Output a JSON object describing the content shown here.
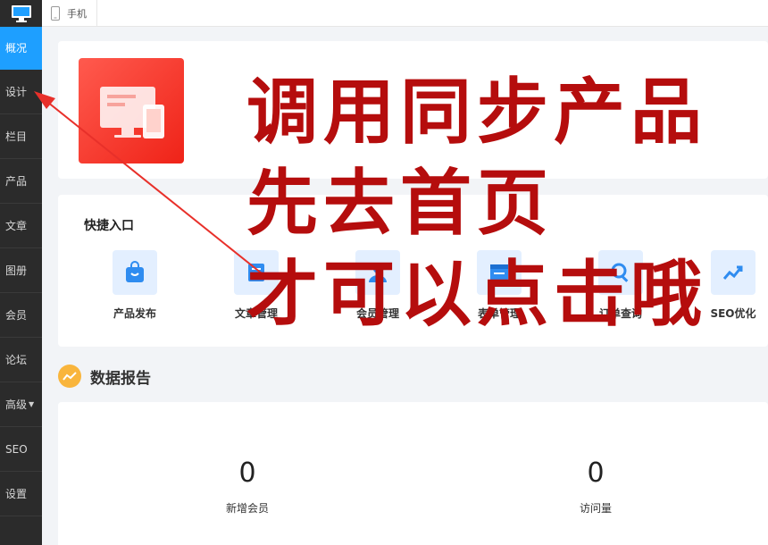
{
  "sidebar": {
    "logo_icon": "monitor-icon",
    "items": [
      {
        "label": "概况",
        "active": true
      },
      {
        "label": "设计"
      },
      {
        "label": "栏目"
      },
      {
        "label": "产品"
      },
      {
        "label": "文章"
      },
      {
        "label": "图册"
      },
      {
        "label": "会员"
      },
      {
        "label": "论坛"
      },
      {
        "label": "高级",
        "has_dropdown": true
      },
      {
        "label": "SEO"
      },
      {
        "label": "设置"
      }
    ]
  },
  "topbar": {
    "phone_tab_label": "手机"
  },
  "quick": {
    "title": "快捷入口",
    "items": [
      {
        "label": "产品发布",
        "icon": "shopping-bag-icon"
      },
      {
        "label": "文章管理",
        "icon": "document-icon"
      },
      {
        "label": "会员管理",
        "icon": "user-icon"
      },
      {
        "label": "表单管理",
        "icon": "form-icon"
      },
      {
        "label": "订单查询",
        "icon": "search-icon"
      },
      {
        "label": "SEO优化",
        "icon": "trend-chart-icon"
      }
    ]
  },
  "report": {
    "title": "数据报告",
    "stats": [
      {
        "value": "0",
        "label": "新增会员"
      },
      {
        "value": "0",
        "label": "访问量"
      }
    ]
  },
  "overlay": {
    "lines": [
      "调用同步产品",
      "先去首页",
      "才可以点击哦"
    ],
    "color": "#b50d0d"
  },
  "colors": {
    "accent": "#1e9fff",
    "sidebar_bg": "#2b2b2b",
    "hero_red": "#ef2318"
  }
}
